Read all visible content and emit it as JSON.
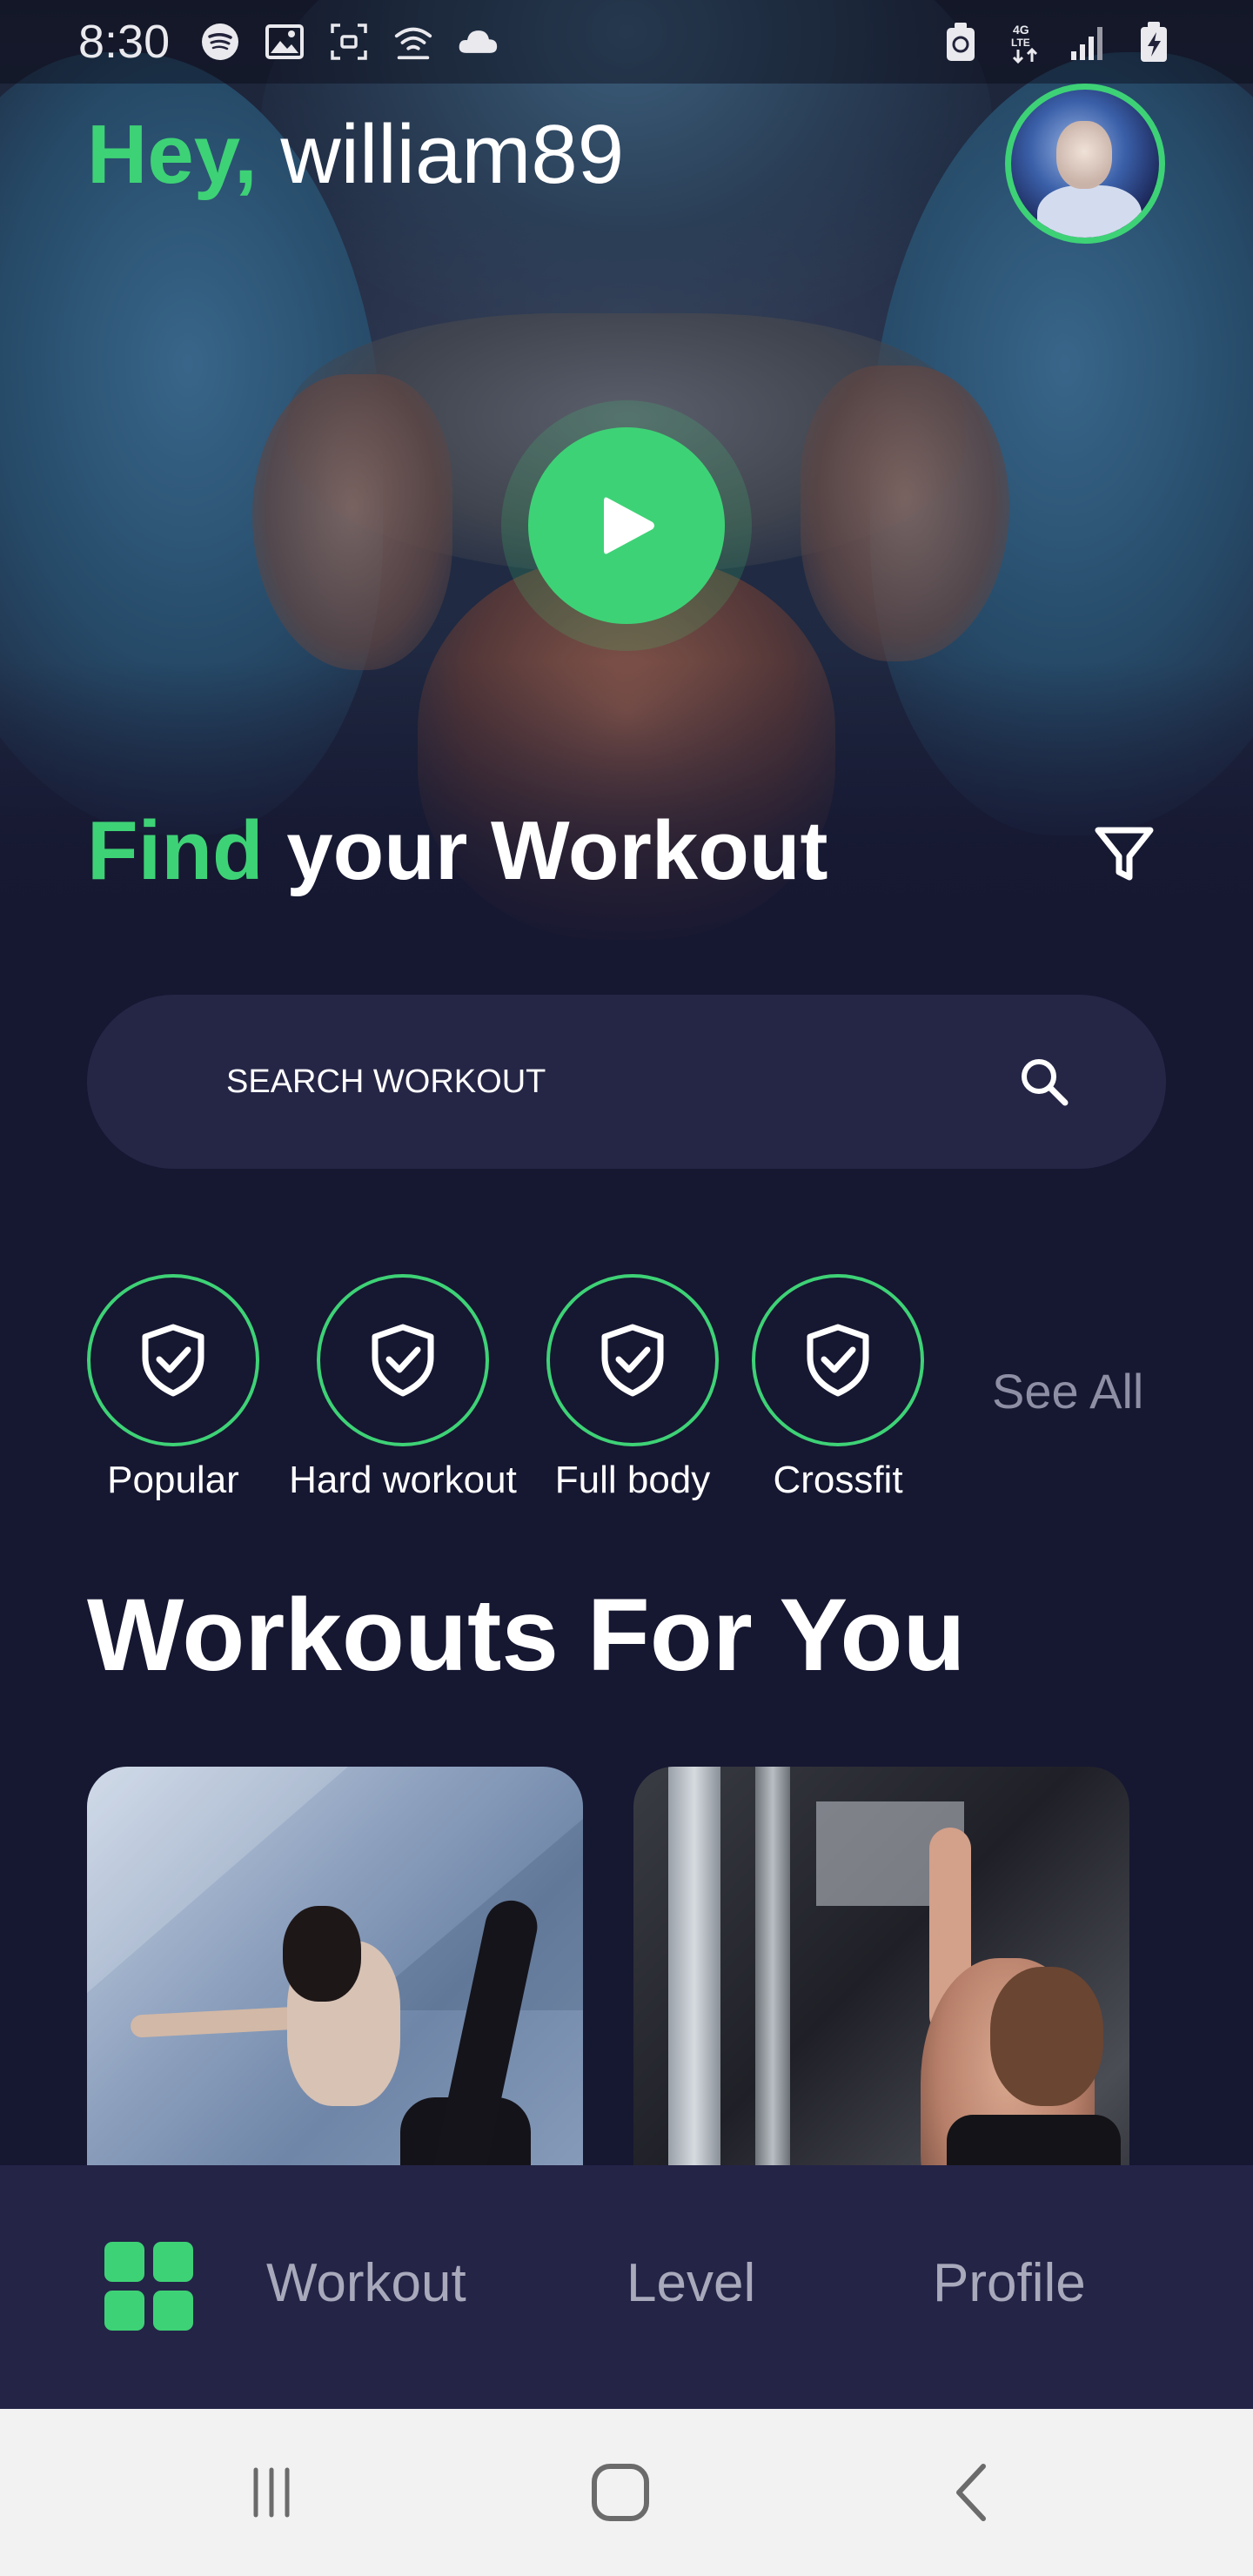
{
  "status_bar": {
    "time": "8:30",
    "left_icons": [
      "spotify-icon",
      "image-icon",
      "screenshot-icon",
      "wifi-call-icon",
      "cloud-icon"
    ],
    "right_icons": [
      "battery-saver-icon",
      "4g-lte-icon",
      "signal-icon",
      "battery-charging-icon"
    ]
  },
  "header": {
    "greeting_accent": "Hey,",
    "username": "william89",
    "avatar_icon": "user-avatar"
  },
  "hero": {
    "play_icon": "play-icon"
  },
  "find_section": {
    "title_accent": "Find",
    "title_rest": "your Workout",
    "filter_icon": "filter-icon"
  },
  "search": {
    "placeholder": "SEARCH WORKOUT",
    "value": "",
    "icon": "search-icon"
  },
  "categories": {
    "items": [
      {
        "label": "Popular",
        "icon": "shield-check-icon"
      },
      {
        "label": "Hard workout",
        "icon": "shield-check-icon"
      },
      {
        "label": "Full body",
        "icon": "shield-check-icon"
      },
      {
        "label": "Crossfit",
        "icon": "shield-check-icon"
      }
    ],
    "see_all": "See All"
  },
  "workouts": {
    "title": "Workouts For You",
    "cards": [
      {
        "image": "yoga-dancer-pose-photo"
      },
      {
        "image": "gym-cable-pulldown-photo"
      }
    ]
  },
  "bottom_nav": {
    "home_icon": "grid-icon",
    "items": [
      "Workout",
      "Level",
      "Profile"
    ]
  },
  "system_nav": {
    "buttons": [
      "recent-apps-icon",
      "home-icon",
      "back-icon"
    ]
  },
  "colors": {
    "accent": "#3ed276",
    "background": "#161731",
    "surface": "#252646",
    "nav_background": "#242447",
    "muted_text": "#a9a9bc"
  }
}
